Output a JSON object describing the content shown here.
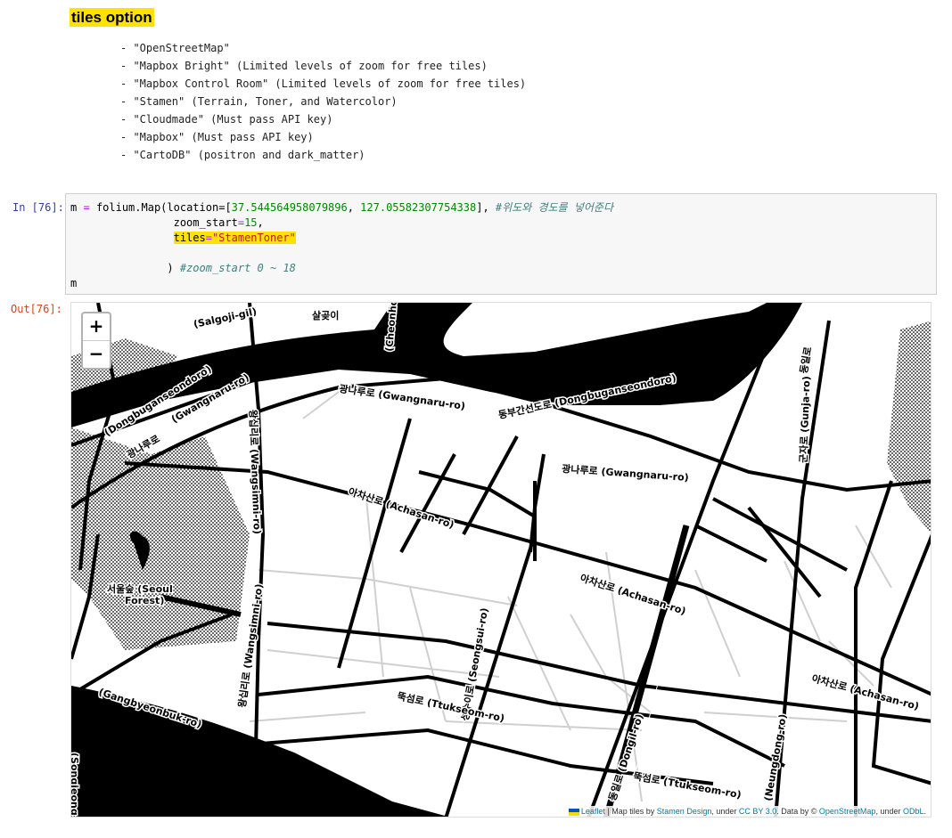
{
  "markdown": {
    "heading": "tiles option",
    "items": [
      "- \"OpenStreetMap\"",
      "- \"Mapbox Bright\" (Limited levels of zoom for free tiles)",
      "- \"Mapbox Control Room\" (Limited levels of zoom for free tiles)",
      "- \"Stamen\" (Terrain, Toner, and Watercolor)",
      "- \"Cloudmade\" (Must pass API key)",
      "- \"Mapbox\" (Must pass API key)",
      "- \"CartoDB\" (positron and dark_matter)"
    ]
  },
  "cell": {
    "in_prompt": "In [76]:",
    "out_prompt": "Out[76]:",
    "code": {
      "var": "m",
      "call": "folium.Map(location=",
      "lat": "37.544564958079896",
      "lon": "127.05582307754338",
      "comment1": "#위도와 경도를 넣어준다",
      "zoom_kw": "zoom_start",
      "zoom_val": "15",
      "tiles_kw": "tiles",
      "tiles_val": "\"StamenToner\"",
      "close": ")",
      "comment2": "#zoom_start 0 ~ 18",
      "last": "m"
    }
  },
  "map": {
    "zoom_in": "+",
    "zoom_out": "−",
    "labels": {
      "salgoji": "(Salgoji-gil)",
      "salgoji_ko": "살곶이",
      "dongbugan_w": "(Dongbuganseondoro)",
      "gwangnaru_w": "(Gwangnaru-ro)",
      "gwangnaru_ko_w": "광나루로",
      "gwangnaru_top": "광나루로 (Gwangnaru-ro)",
      "dongbugan_e": "동부간선도로 (Dongbuganseondoro)",
      "gwangnaru_e": "광나루로 (Gwangnaru-ro)",
      "achasan_1": "아차산로 (Achasan-ro)",
      "achasan_2": "아차산로 (Achasan-ro)",
      "achasan_3": "아차산로 (Achasan-ro)",
      "wangsimni_1": "왕십리로 (Wangsimni-ro)",
      "wangsimni_2": "왕십리로 (Wangsimni-ro)",
      "forest": "서울숲 (Seoul",
      "forest2": "Forest)",
      "gangbyeonbuk": "(Gangbyeonbuk-ro)",
      "seongsu": "성수이로 (Seongsui-ro)",
      "ttukseom_1": "뚝섬로 (Ttukseom-ro)",
      "ttukseom_2": "뚝섬로 (Ttukseom-ro)",
      "dongil": "동일로 (Dongil-ro)",
      "gunja": "군자로 (Gunja-ro)",
      "dongil_ko": "동일로",
      "neungdong": "(Neungdong-ro)",
      "songjeong": "(Songjeong-ro)",
      "hanwha": "(Cheonhoro)"
    },
    "attribution": {
      "leaflet": "Leaflet",
      "sep1": " | Map tiles by ",
      "stamen": "Stamen Design",
      "sep2": ", under ",
      "ccby": "CC BY 3.0",
      "sep3": ". Data by © ",
      "osm": "OpenStreetMap",
      "sep4": ", under ",
      "odbl": "ODbL",
      "end": "."
    }
  }
}
